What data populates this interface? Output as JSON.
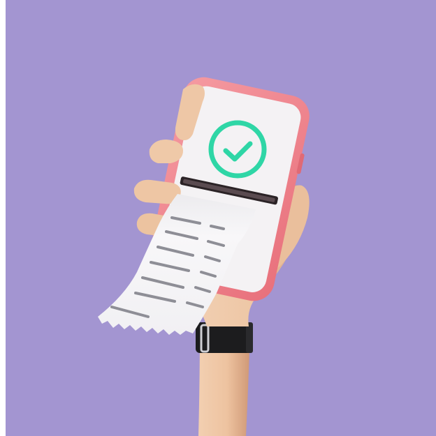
{
  "image": {
    "colors": {
      "background": "#a395d1",
      "skin": "#eec7a6",
      "skin_shadow": "#d9a481",
      "phone_case": "#f0808a",
      "phone_case_dark": "#d9646f",
      "screen": "#f4f2f4",
      "check": "#2fd6a6",
      "receipt": "#f7f6f8",
      "receipt_lines": "#8e8e96",
      "watch_strap": "#1c1c1e",
      "watch_buckle": "#cfcfd4"
    },
    "icons": [
      "checkmark-circle-icon"
    ]
  }
}
